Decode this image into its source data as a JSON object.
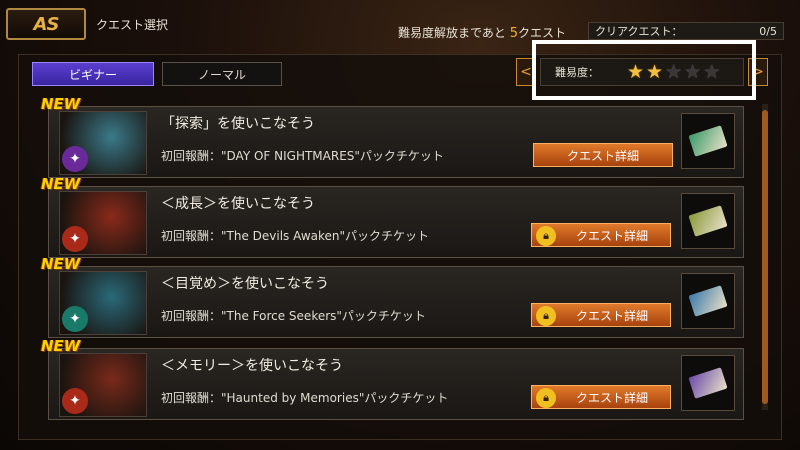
{
  "header": {
    "back_logo": "AS",
    "screen_title": "クエスト選択",
    "unlock_prefix": "難易度解放まであと",
    "unlock_count": "5",
    "unlock_suffix": "クエスト",
    "clear_label": "クリアクエスト：",
    "clear_value": "0/5"
  },
  "tabs": [
    {
      "label": "ビギナー",
      "selected": true
    },
    {
      "label": "ノーマル",
      "selected": false
    }
  ],
  "difficulty": {
    "label": "難易度：",
    "rating": 2,
    "max": 5,
    "prev_glyph": "<",
    "next_glyph": ">"
  },
  "quests": [
    {
      "new_label": "NEW",
      "title": "「探索」を使いこなそう",
      "reward": "初回報酬：\"DAY OF NIGHTMARES\"パックチケット",
      "button": "クエスト詳細",
      "locked": false,
      "emblem_icon": "spider-emblem-icon",
      "portrait_color": "#3a7a8a",
      "emblem_color": "#6a2a9a",
      "ticket_color": "#3a9a6a"
    },
    {
      "new_label": "NEW",
      "title": "＜成長＞を使いこなそう",
      "reward": "初回報酬：\"The Devils Awaken\"パックチケット",
      "button": "クエスト詳細",
      "locked": true,
      "emblem_icon": "flame-emblem-icon",
      "portrait_color": "#8a2a1a",
      "emblem_color": "#aa2a1a",
      "ticket_color": "#8a9a3a"
    },
    {
      "new_label": "NEW",
      "title": "＜目覚め＞を使いこなそう",
      "reward": "初回報酬：\"The Force Seekers\"パックチケット",
      "button": "クエスト詳細",
      "locked": true,
      "emblem_icon": "leaf-emblem-icon",
      "portrait_color": "#2a6a7a",
      "emblem_color": "#1a7a6a",
      "ticket_color": "#3a7aaa"
    },
    {
      "new_label": "NEW",
      "title": "＜メモリー＞を使いこなそう",
      "reward": "初回報酬：\"Haunted by Memories\"パックチケット",
      "button": "クエスト詳細",
      "locked": true,
      "emblem_icon": "flame-emblem-icon",
      "portrait_color": "#7a2a1a",
      "emblem_color": "#aa2a1a",
      "ticket_color": "#6a4aaa"
    }
  ]
}
